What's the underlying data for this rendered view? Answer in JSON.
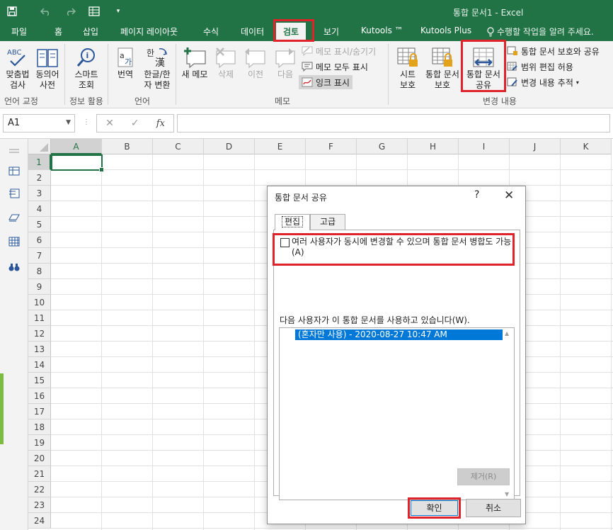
{
  "title_bar": {
    "document_title": "통합 문서1 - Excel",
    "qat_icons": [
      "save-icon",
      "undo-icon",
      "redo-icon",
      "form-icon",
      "customize-icon"
    ]
  },
  "tabs": [
    "파일",
    "홈",
    "삽입",
    "페이지 레이아웃",
    "수식",
    "데이터",
    "검토",
    "보기",
    "Kutools ™",
    "Kutools Plus"
  ],
  "active_tab": "검토",
  "tell_me": "수행할 작업을 알려 주세요.",
  "ribbon": {
    "proofing": {
      "spelling": "맞춤법\n검사",
      "thesaurus": "동의어\n사전",
      "group": "언어 교정"
    },
    "insights": {
      "smart_lookup": "스마트\n조회",
      "group": "정보 활용"
    },
    "language": {
      "translate": "번역",
      "hangul_hanja": "한글/한\n자 변환",
      "group": "언어"
    },
    "comments": {
      "new": "새 메모",
      "delete": "삭제",
      "previous": "이전",
      "next": "다음",
      "show_hide": "메모 표시/숨기기",
      "show_all": "메모 모두 표시",
      "show_ink": "잉크 표시",
      "group": "메모"
    },
    "changes": {
      "protect_sheet": "시트\n보호",
      "protect_workbook": "통합 문서\n보호",
      "share_workbook": "통합 문서\n공유",
      "protect_share": "통합 문서 보호와 공유",
      "allow_edit_ranges": "범위 편집 허용",
      "track_changes": "변경 내용 추적",
      "group": "변경 내용"
    }
  },
  "formula_bar": {
    "name_box": "A1",
    "fx": "fx",
    "value": ""
  },
  "sheet": {
    "columns": [
      "A",
      "B",
      "C",
      "D",
      "E",
      "F",
      "G",
      "H",
      "I",
      "J",
      "K"
    ],
    "rows": [
      "1",
      "2",
      "3",
      "4",
      "5",
      "6",
      "7",
      "8",
      "9",
      "10",
      "11",
      "12",
      "13",
      "14",
      "15",
      "16",
      "17",
      "18",
      "19",
      "20",
      "21",
      "22",
      "23",
      "24"
    ],
    "active_cell": "A1"
  },
  "dialog": {
    "title": "통합 문서 공유",
    "help": "?",
    "close": "✕",
    "tabs": [
      "편집",
      "고급"
    ],
    "checkbox_label": "여러 사용자가 동시에 변경할 수 있으며 통합 문서 병합도 가능(A)",
    "checkbox_checked": false,
    "users_label": "다음 사용자가 이 통합 문서를 사용하고 있습니다(W).",
    "users": [
      "(혼자만 사용) - 2020-08-27 10:47 AM"
    ],
    "remove_button": "제거(R)",
    "ok_button": "확인",
    "cancel_button": "취소"
  },
  "colors": {
    "excel_green": "#217346",
    "highlight_red": "#e0232b",
    "selection_blue": "#0078d7"
  }
}
